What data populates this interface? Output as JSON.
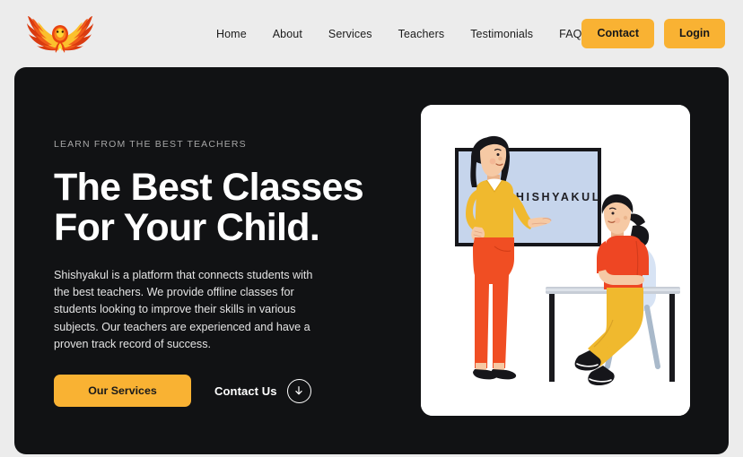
{
  "brand": {
    "logo_icon": "phoenix-wings-logo",
    "colors": {
      "flame_outer": "#d93b10",
      "flame_mid": "#f05a1a",
      "flame_inner": "#fbc02d"
    }
  },
  "nav": {
    "links": [
      {
        "label": "Home"
      },
      {
        "label": "About"
      },
      {
        "label": "Services"
      },
      {
        "label": "Teachers"
      },
      {
        "label": "Testimonials"
      },
      {
        "label": "FAQ"
      }
    ],
    "contact_button": "Contact",
    "login_button": "Login"
  },
  "hero": {
    "eyebrow": "LEARN FROM THE BEST TEACHERS",
    "headline": "The Best Classes For Your Child.",
    "subcopy": "Shishyakul is a platform that connects students with the best teachers. We provide offline classes for students looking to improve their skills in various subjects. Our teachers are experienced and have a proven track record of success.",
    "primary_cta": "Our Services",
    "secondary_cta": "Contact Us",
    "secondary_cta_icon": "arrow-down-circle-icon"
  },
  "illustration": {
    "alt": "teacher-pointing-at-whiteboard-with-seated-student",
    "whiteboard_text": "SHISHYAKUL",
    "figures": [
      {
        "role": "teacher",
        "shirt": "#f0b92e",
        "pants": "#f04e23",
        "hair": "#16161a",
        "shoes": "#16161a"
      },
      {
        "role": "student",
        "shirt": "#ee4623",
        "pants": "#f0b92e",
        "hair": "#16161a",
        "shoes": "#16161a"
      }
    ]
  },
  "theme": {
    "page_bg": "#ececec",
    "hero_bg": "#111214",
    "accent": "#f9b233",
    "card_bg": "#ffffff",
    "whiteboard_fill": "#c6d5ec",
    "whiteboard_border": "#16161a",
    "chair_fill": "#d7e3f4",
    "desk_top": "#c7cdd6",
    "skin": "#f6c9a4"
  }
}
